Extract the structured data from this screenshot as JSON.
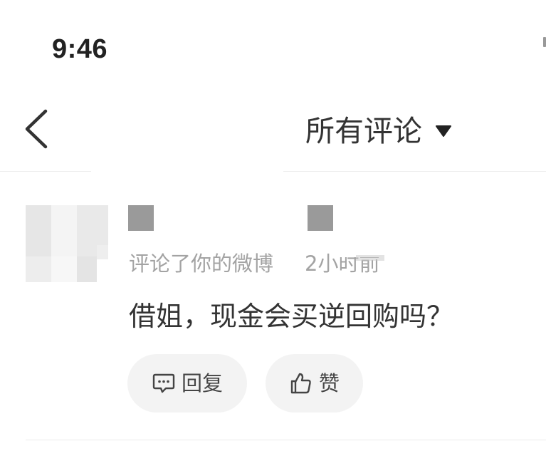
{
  "status_bar": {
    "time": "9:46"
  },
  "nav": {
    "title": "所有评论",
    "back_icon": "chevron-left-icon",
    "dropdown_icon": "caret-down-icon"
  },
  "comment": {
    "action_text": "评论了你的微博",
    "time": "2小时前",
    "text": "借姐，现金会买逆回购吗？",
    "reply_label": "回复",
    "reply_icon": "comment-reply-icon",
    "like_label": "赞",
    "like_icon": "thumbs-up-icon"
  },
  "colors": {
    "text_primary": "#333333",
    "text_secondary": "#a3a3a3",
    "pill_background": "#f3f3f3",
    "redaction": "#9a9a9a"
  }
}
